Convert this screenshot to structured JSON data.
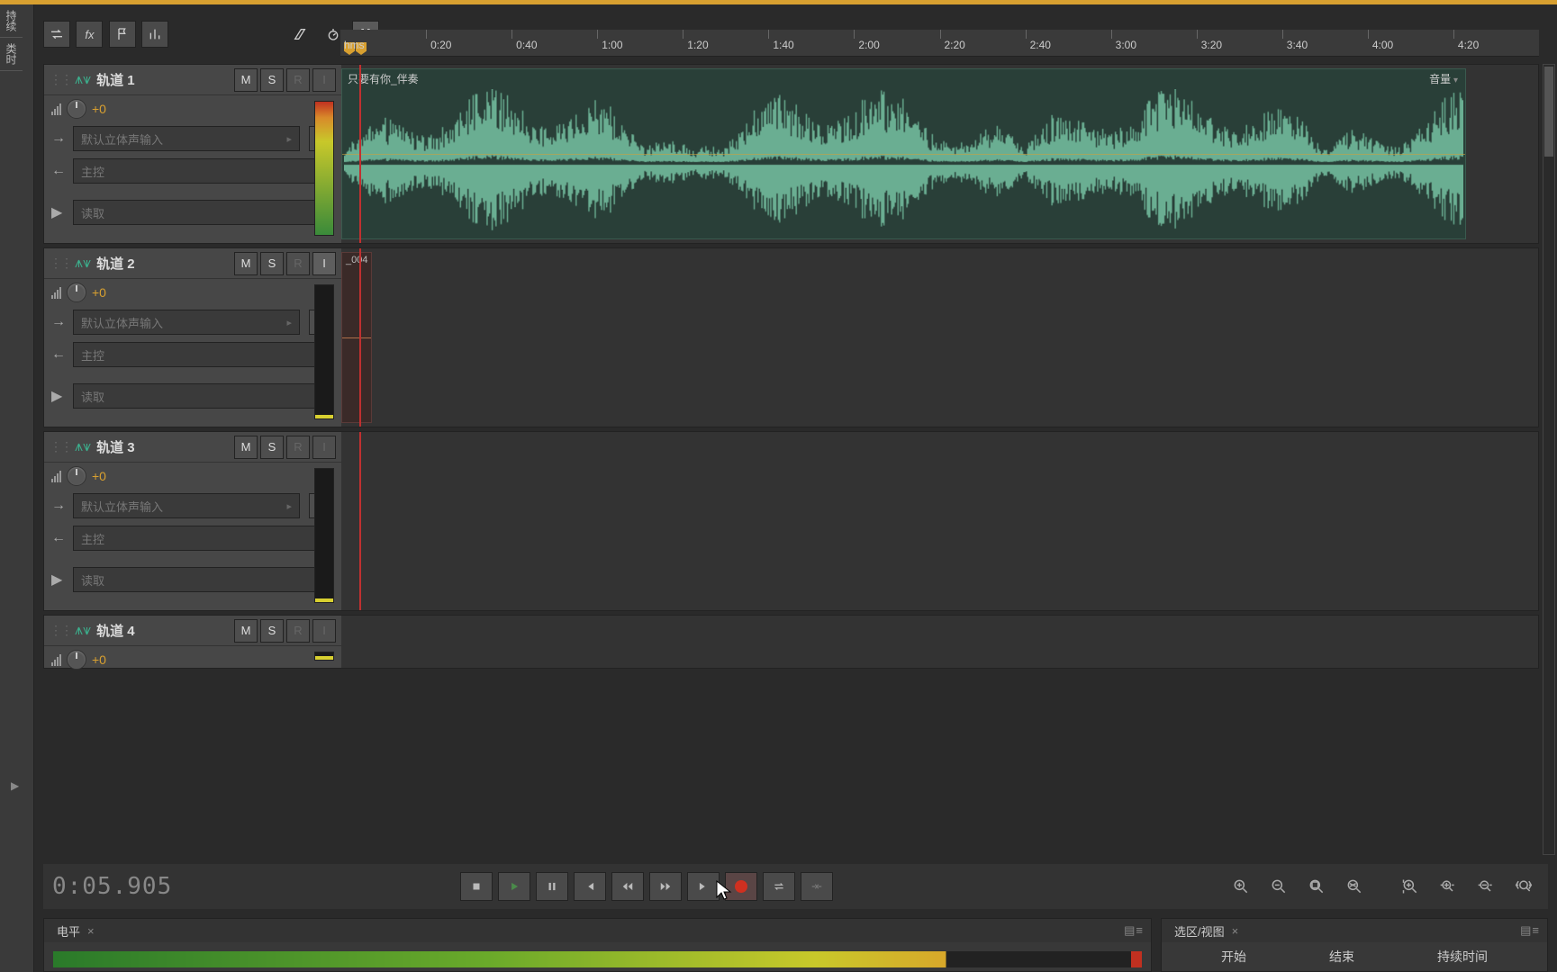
{
  "left_tabs": [
    "持续",
    "类时"
  ],
  "toolbar": {
    "loop": "loop",
    "fx": "fx",
    "flag": "flag",
    "bars": "bars",
    "skew": "skew",
    "clock": "clock",
    "snap": "snap"
  },
  "ruler": {
    "hms": "hms",
    "marks": [
      "0:20",
      "0:40",
      "1:00",
      "1:20",
      "1:40",
      "2:00",
      "2:20",
      "2:40",
      "3:00",
      "3:20",
      "3:40",
      "4:00",
      "4:20"
    ]
  },
  "tracks": [
    {
      "name": "轨道 1",
      "gain": "+0",
      "input": "默认立体声输入",
      "output": "主控",
      "read": "读取",
      "m": "M",
      "s": "S",
      "r": "R",
      "i": "I",
      "i_on": false,
      "meter": "gradient"
    },
    {
      "name": "轨道 2",
      "gain": "+0",
      "input": "默认立体声输入",
      "output": "主控",
      "read": "读取",
      "m": "M",
      "s": "S",
      "r": "R",
      "i": "I",
      "i_on": true,
      "meter": "dark"
    },
    {
      "name": "轨道 3",
      "gain": "+0",
      "input": "默认立体声输入",
      "output": "主控",
      "read": "读取",
      "m": "M",
      "s": "S",
      "r": "R",
      "i": "I",
      "i_on": false,
      "meter": "dark"
    },
    {
      "name": "轨道 4",
      "gain": "+0",
      "m": "M",
      "s": "S",
      "r": "R",
      "i": "I",
      "i_on": false
    }
  ],
  "clip1": {
    "label": "只要有你_伴奏",
    "vol": "音量"
  },
  "clip2": {
    "label": "_004"
  },
  "transport": {
    "time": "0:05.905"
  },
  "panels": {
    "level": {
      "title": "电平"
    },
    "selection": {
      "title": "选区/视图",
      "cols": [
        "开始",
        "结束",
        "持续时间"
      ]
    }
  }
}
